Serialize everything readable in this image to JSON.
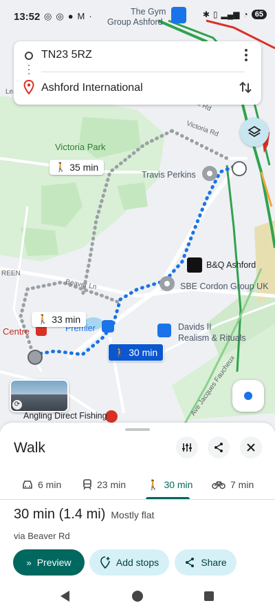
{
  "status_bar": {
    "time": "13:52",
    "battery": "65",
    "notification_icons": [
      "threads-icon",
      "threads-icon",
      "chat-icon",
      "gmail-icon"
    ]
  },
  "route_inputs": {
    "origin": "TN23 5RZ",
    "destination": "Ashford International"
  },
  "map": {
    "labels": {
      "gym": "The Gym",
      "gym2": "Group Ashford",
      "victoria_park": "Victoria Park",
      "victoria_rd": "Victoria Rd",
      "travis_perkins": "Travis Perkins",
      "bq": "B&Q Ashford",
      "sbe": "SBE Cordon Group UK",
      "beaver_ln": "Beaver Ln",
      "premier": "Premier",
      "centre": "Centre",
      "davids": "Davids II",
      "davids2": "Realism & Rituals",
      "angling": "Angling Direct Fishing",
      "ave_jacques": "Ave Jacques Faucheux",
      "leas": "Lea",
      "reen": "REEN",
      "rd_sign": "ck Rd"
    },
    "chips": {
      "alt1": "35 min",
      "alt2": "33 min",
      "selected": "30 min"
    }
  },
  "sheet": {
    "title": "Walk",
    "modes": [
      {
        "icon": "car-icon",
        "label": "6 min"
      },
      {
        "icon": "train-icon",
        "label": "23 min"
      },
      {
        "icon": "walk-icon",
        "label": "30 min"
      },
      {
        "icon": "bike-icon",
        "label": "7 min"
      }
    ],
    "active_mode": "walk",
    "duration": "30 min (1.4 mi)",
    "terrain": "Mostly flat",
    "via": "via Beaver Rd",
    "buttons": {
      "preview": "Preview",
      "add_stops": "Add stops",
      "share": "Share"
    }
  },
  "colors": {
    "route_blue": "#1a73e8",
    "accent_teal": "#00685f",
    "tonal_bg": "#d5f1f7",
    "park_green": "#c8ebc4",
    "rail_green": "#2fa24f"
  }
}
